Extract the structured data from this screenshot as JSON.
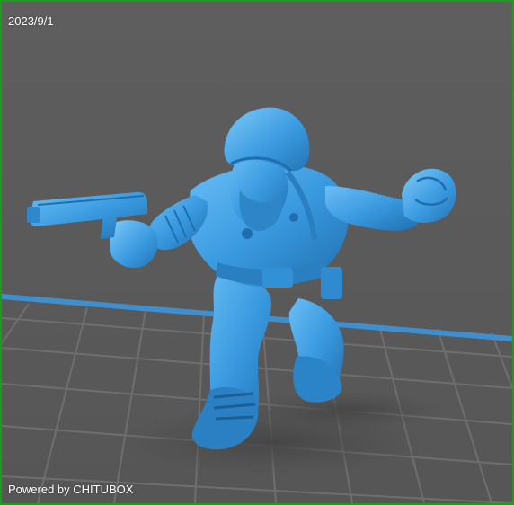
{
  "viewer": {
    "date": "2023/9/1",
    "watermark": "Powered by CHITUBOX"
  },
  "colors": {
    "background": "#5a5a5a",
    "grid_line": "#6f6f6f",
    "platform_edge": "#3f8fcf",
    "model": "#3b9be0",
    "model_dark": "#1f6fae",
    "model_light": "#69bdf4",
    "shadow": "#4a4a4a",
    "frame": "#1f9a1f"
  }
}
